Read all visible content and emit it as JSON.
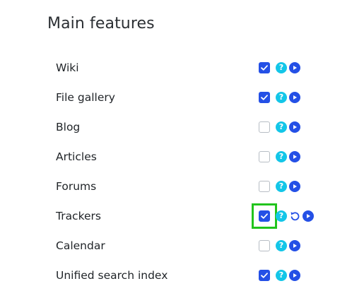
{
  "section": {
    "title": "Main features"
  },
  "colors": {
    "checked": "#2450e6",
    "help": "#13c6e8",
    "play": "#2450e6",
    "highlight": "#22c41d"
  },
  "features": [
    {
      "label": "Wiki",
      "checked": true,
      "help_glyph": "?",
      "has_reset": false,
      "highlighted": false
    },
    {
      "label": "File gallery",
      "checked": true,
      "help_glyph": "?",
      "has_reset": false,
      "highlighted": false
    },
    {
      "label": "Blog",
      "checked": false,
      "help_glyph": "?",
      "has_reset": false,
      "highlighted": false
    },
    {
      "label": "Articles",
      "checked": false,
      "help_glyph": "?",
      "has_reset": false,
      "highlighted": false
    },
    {
      "label": "Forums",
      "checked": false,
      "help_glyph": "?",
      "has_reset": false,
      "highlighted": false
    },
    {
      "label": "Trackers",
      "checked": true,
      "help_glyph": "?",
      "has_reset": true,
      "highlighted": true
    },
    {
      "label": "Calendar",
      "checked": false,
      "help_glyph": "?",
      "has_reset": false,
      "highlighted": false
    },
    {
      "label": "Unified search index",
      "checked": true,
      "help_glyph": "?",
      "has_reset": false,
      "highlighted": false
    }
  ]
}
